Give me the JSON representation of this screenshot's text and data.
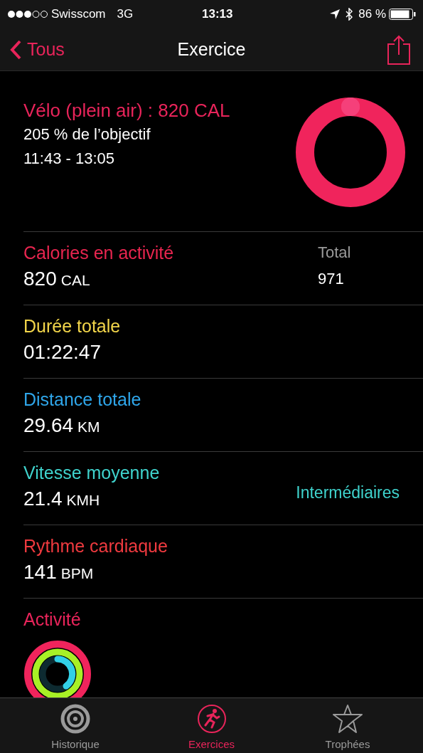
{
  "status_bar": {
    "carrier": "Swisscom",
    "network": "3G",
    "time": "13:13",
    "battery": "86 %"
  },
  "nav": {
    "back": "Tous",
    "title": "Exercice"
  },
  "summary": {
    "title": "Vélo (plein air) : 820 CAL",
    "goal": "205 % de l’objectif",
    "time": "11:43 - 13:05"
  },
  "metrics": [
    {
      "label": "Calories en activité",
      "color": "#e8254f",
      "value": "820",
      "unit": "CAL",
      "extra_label": "Total",
      "extra_value": "971"
    },
    {
      "label": "Durée totale",
      "color": "#f2d54a",
      "value": "01:22:47"
    },
    {
      "label": "Distance totale",
      "color": "#2fa6ea",
      "value": "29.64",
      "unit": "KM"
    },
    {
      "label": "Vitesse moyenne",
      "color": "#3fd3cd",
      "value": "21.4",
      "unit": "KMH",
      "link": "Intermédiaires"
    },
    {
      "label": "Rythme cardiaque",
      "color": "#ef3a3f",
      "value": "141",
      "unit": "BPM"
    }
  ],
  "activity": {
    "label": "Activité"
  },
  "tabs": [
    {
      "label": "Historique",
      "selected": false
    },
    {
      "label": "Exercices",
      "selected": true
    },
    {
      "label": "Trophées",
      "selected": false
    }
  ]
}
